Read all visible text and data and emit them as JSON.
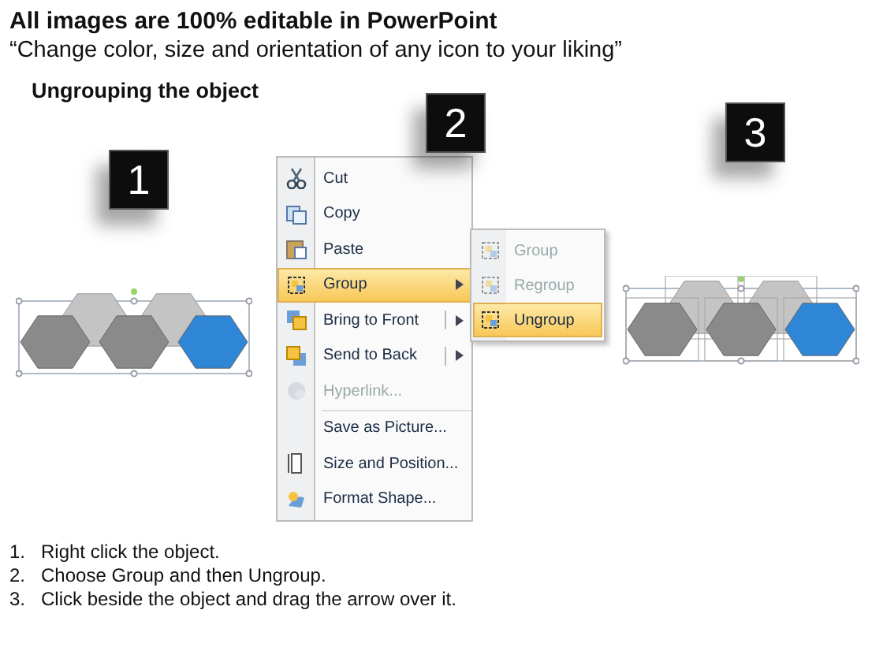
{
  "header": {
    "title": "All images are 100% editable in PowerPoint",
    "subtitle": "“Change color, size and orientation of any icon to your liking”",
    "heading": "Ungrouping the object"
  },
  "steps": [
    {
      "number": "1"
    },
    {
      "number": "2"
    },
    {
      "number": "3"
    }
  ],
  "context_menu": {
    "items": [
      {
        "label": "Cut",
        "selected": false,
        "disabled": false,
        "submenu": false
      },
      {
        "label": "Copy",
        "selected": false,
        "disabled": false,
        "submenu": false
      },
      {
        "label": "Paste",
        "selected": false,
        "disabled": false,
        "submenu": false
      },
      {
        "label": "Group",
        "selected": true,
        "disabled": false,
        "submenu": true
      },
      {
        "label": "Bring to Front",
        "selected": false,
        "disabled": false,
        "submenu": true
      },
      {
        "label": "Send to Back",
        "selected": false,
        "disabled": false,
        "submenu": true
      },
      {
        "label": "Hyperlink...",
        "selected": false,
        "disabled": true,
        "submenu": false
      },
      {
        "label": "Save as Picture...",
        "selected": false,
        "disabled": false,
        "submenu": false
      },
      {
        "label": "Size and Position...",
        "selected": false,
        "disabled": false,
        "submenu": false
      },
      {
        "label": "Format Shape...",
        "selected": false,
        "disabled": false,
        "submenu": false
      }
    ],
    "submenu": [
      {
        "label": "Group",
        "selected": false,
        "disabled": true
      },
      {
        "label": "Regroup",
        "selected": false,
        "disabled": true
      },
      {
        "label": "Ungroup",
        "selected": true,
        "disabled": false
      }
    ]
  },
  "instructions": [
    {
      "number": "1.",
      "text": "Right click the object."
    },
    {
      "number": "2.",
      "text": "Choose Group and then Ungroup."
    },
    {
      "number": "3.",
      "text": "Click beside the object and drag the arrow over it."
    }
  ]
}
